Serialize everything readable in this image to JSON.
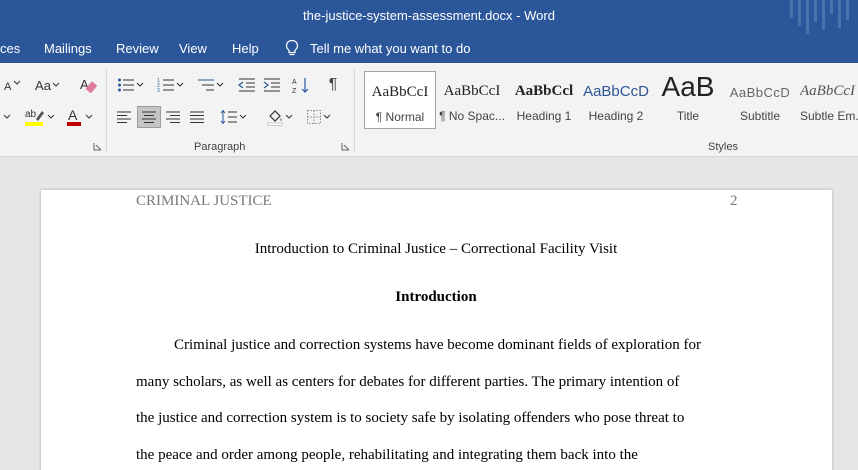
{
  "window": {
    "title": "the-justice-system-assessment.docx  -  Word"
  },
  "tabs": [
    "ces",
    "Mailings",
    "Review",
    "View",
    "Help"
  ],
  "tell_me": "Tell me what you want to do",
  "ribbon": {
    "font_size_label": "Aa",
    "paragraph_group_label": "Paragraph",
    "styles_group_label": "Styles",
    "styles": [
      {
        "sample": "AaBbCcI",
        "name": "¶ Normal",
        "selected": true
      },
      {
        "sample": "AaBbCcI",
        "name": "¶ No Spac..."
      },
      {
        "sample": "AaBbCcl",
        "name": "Heading 1"
      },
      {
        "sample": "AaBbCcD",
        "name": "Heading 2"
      },
      {
        "sample": "AaB",
        "name": "Title"
      },
      {
        "sample": "AaBbCcD",
        "name": "Subtitle"
      },
      {
        "sample": "AaBbCcI",
        "name": "Subtle Em..."
      }
    ],
    "colors": {
      "highlight": "#ffff00",
      "font_color": "#c00000",
      "accent": "#2b579a"
    }
  },
  "document": {
    "header_left": "CRIMINAL JUSTICE",
    "page_number": "2",
    "title": "Introduction to Criminal Justice – Correctional Facility Visit",
    "heading": "Introduction",
    "lines": [
      "Criminal justice and correction systems have become dominant fields of exploration for",
      "many scholars, as well as centers for debates for different parties. The primary intention of",
      "the justice and correction system is to society safe by isolating offenders who pose threat to",
      "the peace and order among people, rehabilitating and integrating them back into the"
    ]
  }
}
